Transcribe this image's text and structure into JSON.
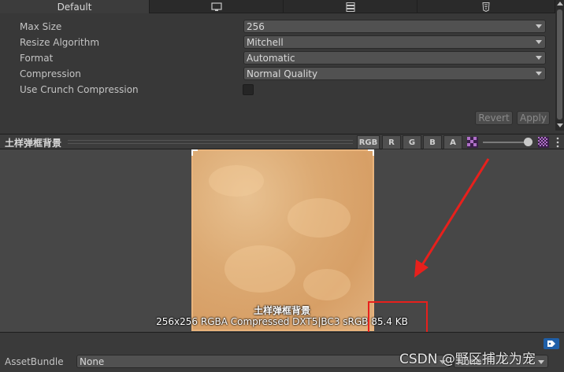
{
  "tabs": [
    {
      "label": "Default",
      "icon": ""
    },
    {
      "label": "",
      "icon": "monitor-icon"
    },
    {
      "label": "",
      "icon": "server-icon"
    },
    {
      "label": "",
      "icon": "html5-icon"
    }
  ],
  "settings": {
    "max_size": {
      "label": "Max Size",
      "value": "256"
    },
    "resize_algorithm": {
      "label": "Resize Algorithm",
      "value": "Mitchell"
    },
    "format": {
      "label": "Format",
      "value": "Automatic"
    },
    "compression": {
      "label": "Compression",
      "value": "Normal Quality"
    },
    "crunch": {
      "label": "Use Crunch Compression",
      "checked": false
    }
  },
  "buttons": {
    "revert": "Revert",
    "apply": "Apply"
  },
  "preview": {
    "title": "土样弹框背景",
    "channels": [
      "RGB",
      "R",
      "G",
      "B",
      "A"
    ],
    "active_channel": "RGB",
    "texture_name": "土样弹框背景",
    "texture_info": "256x256  RGBA Compressed DXT5|BC3 sRGB  85.4 KB"
  },
  "asset_bundle": {
    "label": "AssetBundle",
    "value": "None",
    "variant": "None"
  },
  "watermark": "CSDN @野区捕龙为宠",
  "colors": {
    "annotation_red": "#e8201c",
    "texture_tan": "#dcaa73"
  }
}
